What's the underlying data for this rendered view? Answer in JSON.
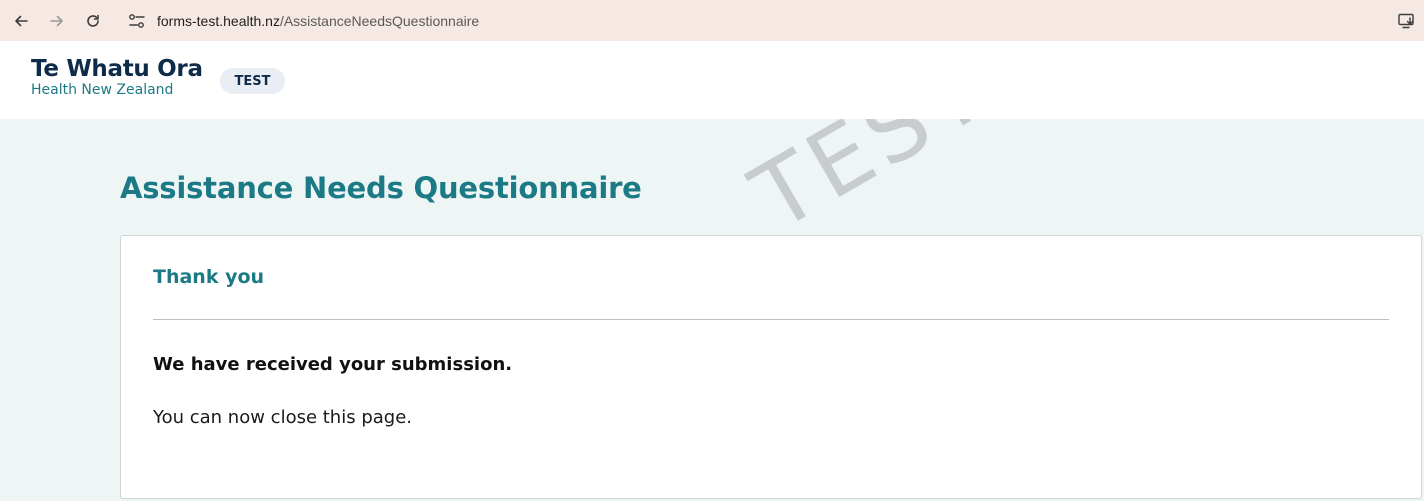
{
  "browser": {
    "url_host": "forms-test.health.nz",
    "url_path": "/AssistanceNeedsQuestionnaire",
    "icons": {
      "back": "arrow-left-icon",
      "forward": "arrow-right-icon",
      "reload": "reload-icon",
      "site_info": "site-settings-icon",
      "install": "install-app-icon"
    }
  },
  "header": {
    "brand_title": "Te Whatu Ora",
    "brand_subtitle": "Health New Zealand",
    "env_badge": "TEST"
  },
  "main": {
    "watermark": "TEST",
    "page_title": "Assistance Needs Questionnaire",
    "card": {
      "heading": "Thank you",
      "message_strong": "We have received your submission.",
      "message": "You can now close this page."
    }
  },
  "colors": {
    "accent_teal": "#1b7a85",
    "brand_navy": "#0f2b4a",
    "page_background": "#eef5f5",
    "browser_bar": "#f6e9e4"
  }
}
